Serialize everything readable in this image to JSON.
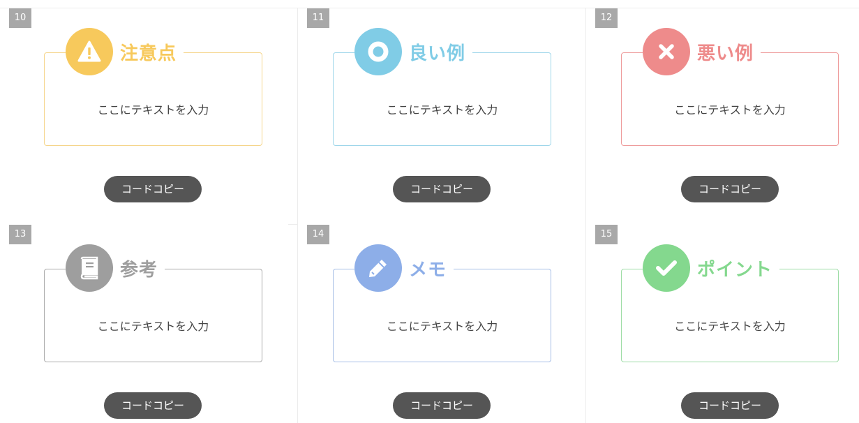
{
  "cards": [
    {
      "number": "10",
      "title": "注意点",
      "text": "ここにテキストを入力",
      "button": "コードコピー",
      "icon": "warning-icon",
      "color": "#f7c95c",
      "border": "#f5d58a"
    },
    {
      "number": "11",
      "title": "良い例",
      "text": "ここにテキストを入力",
      "button": "コードコピー",
      "icon": "circle-o-icon",
      "color": "#80cce6",
      "border": "#9ed6ea"
    },
    {
      "number": "12",
      "title": "悪い例",
      "text": "ここにテキストを入力",
      "button": "コードコピー",
      "icon": "x-icon",
      "color": "#ee8b8b",
      "border": "#ee9b9b"
    },
    {
      "number": "13",
      "title": "参考",
      "text": "ここにテキストを入力",
      "button": "コードコピー",
      "icon": "book-icon",
      "color": "#9e9e9e",
      "border": "#aaaaaa"
    },
    {
      "number": "14",
      "title": "メモ",
      "text": "ここにテキストを入力",
      "button": "コードコピー",
      "icon": "pencil-icon",
      "color": "#8daee8",
      "border": "#a6bee6"
    },
    {
      "number": "15",
      "title": "ポイント",
      "text": "ここにテキストを入力",
      "button": "コードコピー",
      "icon": "check-icon",
      "color": "#84d88e",
      "border": "#9ddca5"
    }
  ]
}
